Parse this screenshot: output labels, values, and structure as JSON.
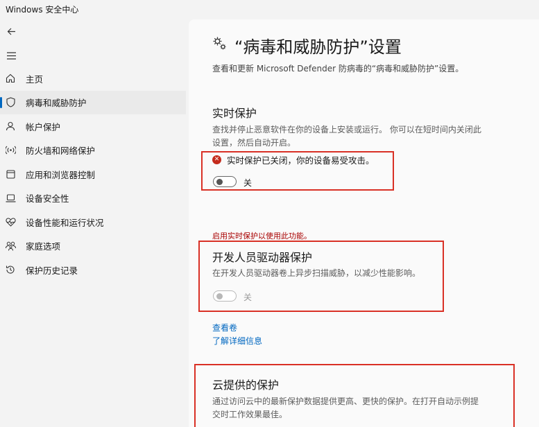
{
  "window": {
    "title": "Windows 安全中心"
  },
  "sidebar": {
    "items": [
      {
        "label": "主页",
        "icon": "home-icon"
      },
      {
        "label": "病毒和威胁防护",
        "icon": "shield-icon",
        "active": true
      },
      {
        "label": "帐户保护",
        "icon": "person-icon"
      },
      {
        "label": "防火墙和网络保护",
        "icon": "wifi-signal-icon"
      },
      {
        "label": "应用和浏览器控制",
        "icon": "app-window-icon"
      },
      {
        "label": "设备安全性",
        "icon": "laptop-icon"
      },
      {
        "label": "设备性能和运行状况",
        "icon": "heart-pulse-icon"
      },
      {
        "label": "家庭选项",
        "icon": "family-icon"
      },
      {
        "label": "保护历史记录",
        "icon": "history-icon"
      }
    ]
  },
  "main": {
    "title": "“病毒和威胁防护”设置",
    "subtitle": "查看和更新 Microsoft Defender 防病毒的“病毒和威胁防护”设置。",
    "realtime": {
      "heading": "实时保护",
      "desc_line1": "查找并停止恶意软件在你的设备上安装或运行。 你可以在短时间内关闭此",
      "desc_line2": "设置，然后自动开启。",
      "warning": "实时保护已关闭，你的设备易受攻击。",
      "toggle_label": "关"
    },
    "enable_note": "启用实时保护以使用此功能。",
    "dev_drive": {
      "heading": "开发人员驱动器保护",
      "desc": "在开发人员驱动器卷上异步扫描威胁，以减少性能影响。",
      "toggle_label": "关"
    },
    "links": {
      "view_volumes": "查看卷",
      "learn_more": "了解详细信息"
    },
    "cloud": {
      "heading": "云提供的保护",
      "desc_line1": "通过访问云中的最新保护数据提供更高、更快的保护。在打开自动示例提",
      "desc_line2": "交时工作效果最佳。"
    }
  },
  "colors": {
    "accent": "#0067c0",
    "highlight_box": "#d93025",
    "error_text": "#a80000"
  }
}
